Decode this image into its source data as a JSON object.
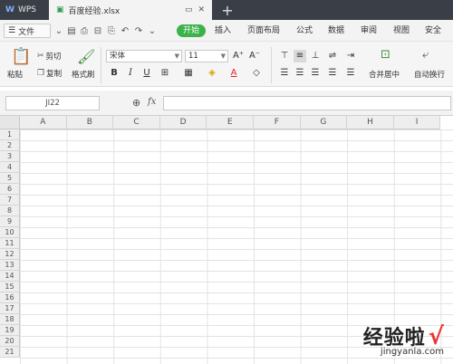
{
  "tabs": {
    "wps": "WPS",
    "file": "百度经验.xlsx",
    "add": "+"
  },
  "menubar": {
    "file_menu": "文件",
    "items": [
      "开始",
      "插入",
      "页面布局",
      "公式",
      "数据",
      "审阅",
      "视图",
      "安全"
    ],
    "active": "开始"
  },
  "ribbon": {
    "paste": "粘贴",
    "cut": "剪切",
    "copy": "复制",
    "format_painter": "格式刷",
    "font_name": "宋体",
    "font_size": "11",
    "bold": "B",
    "italic": "I",
    "underline": "U",
    "merge_center": "合并居中",
    "wrap_text": "自动换行"
  },
  "formula_bar": {
    "name_box": "JI22",
    "fx": "fx",
    "value": ""
  },
  "grid": {
    "columns": [
      "A",
      "B",
      "C",
      "D",
      "E",
      "F",
      "G",
      "H",
      "I"
    ],
    "rows": [
      "1",
      "2",
      "3",
      "4",
      "5",
      "6",
      "7",
      "8",
      "9",
      "10",
      "11",
      "12",
      "13",
      "14",
      "15",
      "16",
      "17",
      "18",
      "19",
      "20",
      "21"
    ]
  },
  "watermark": {
    "text": "经验啦",
    "check": "√",
    "url": "jingyanla.com"
  },
  "colors": {
    "accent": "#3bb24a",
    "titlebar": "#3a3f47"
  }
}
